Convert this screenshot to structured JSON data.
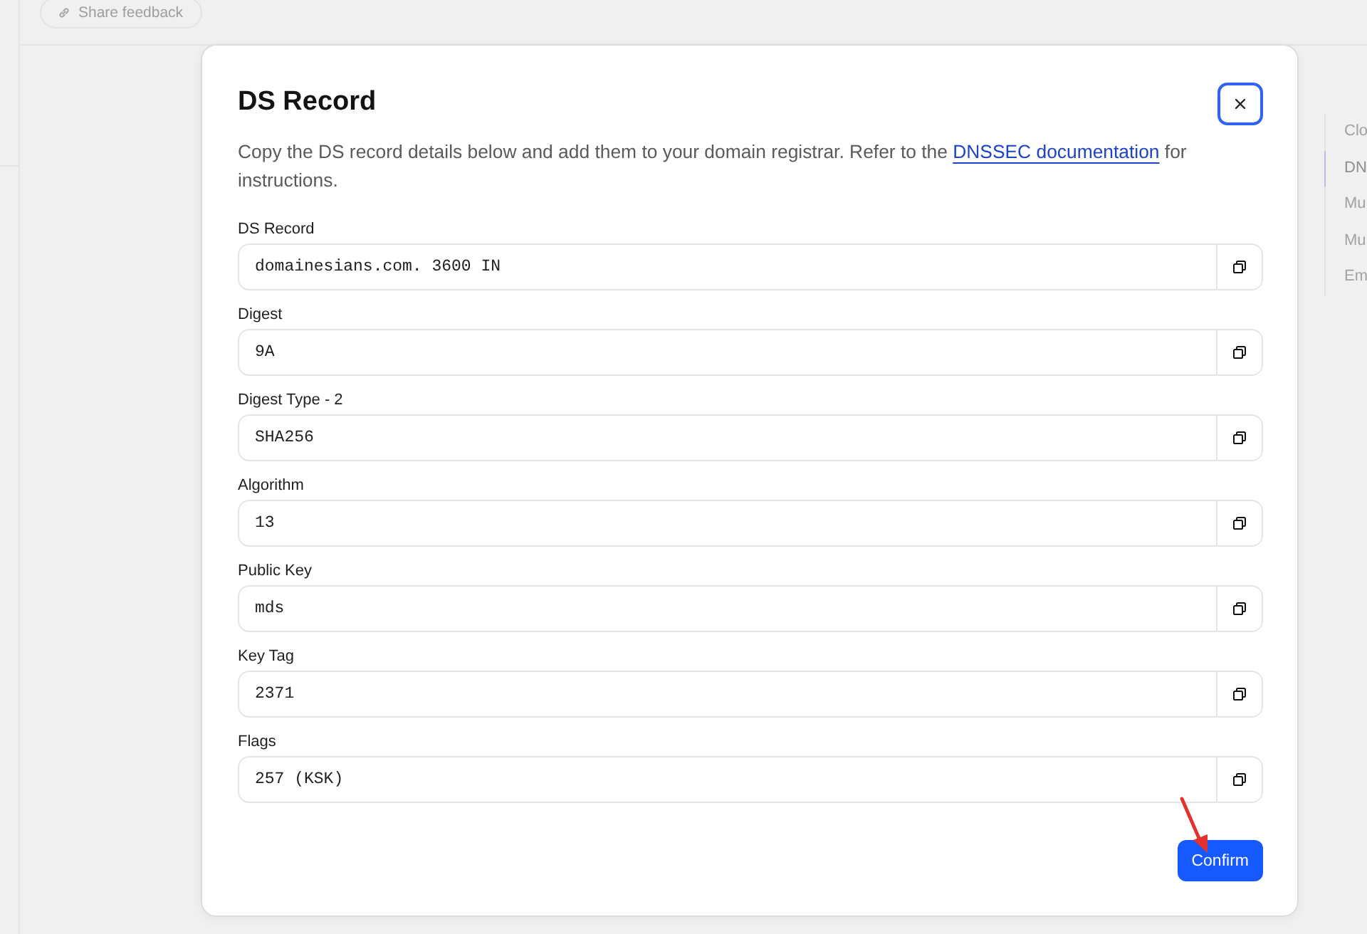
{
  "top_bar": {
    "feedback_button": "Share feedback"
  },
  "side_nav": {
    "items": [
      {
        "label": "Clo",
        "selected": false
      },
      {
        "label": "DN",
        "selected": true
      },
      {
        "label": "Mu",
        "selected": false
      },
      {
        "label": "Mu",
        "selected": false
      },
      {
        "label": "Em",
        "selected": false
      }
    ]
  },
  "dialog": {
    "title": "DS Record",
    "description": {
      "text_before": "Copy the DS record details below and add them to your domain registrar. Refer to the",
      "link": "DNSSEC documentation",
      "text_after": "for instructions."
    },
    "fields": [
      {
        "label": "DS Record",
        "value": "domainesians.com. 3600 IN"
      },
      {
        "label": "Digest",
        "value": "9A"
      },
      {
        "label": "Digest Type - 2",
        "value": "SHA256"
      },
      {
        "label": "Algorithm",
        "value": "13"
      },
      {
        "label": "Public Key",
        "value": "mds"
      },
      {
        "label": "Key Tag",
        "value": "2371"
      },
      {
        "label": "Flags",
        "value": "257 (KSK)"
      }
    ],
    "confirm_button": "Confirm"
  }
}
